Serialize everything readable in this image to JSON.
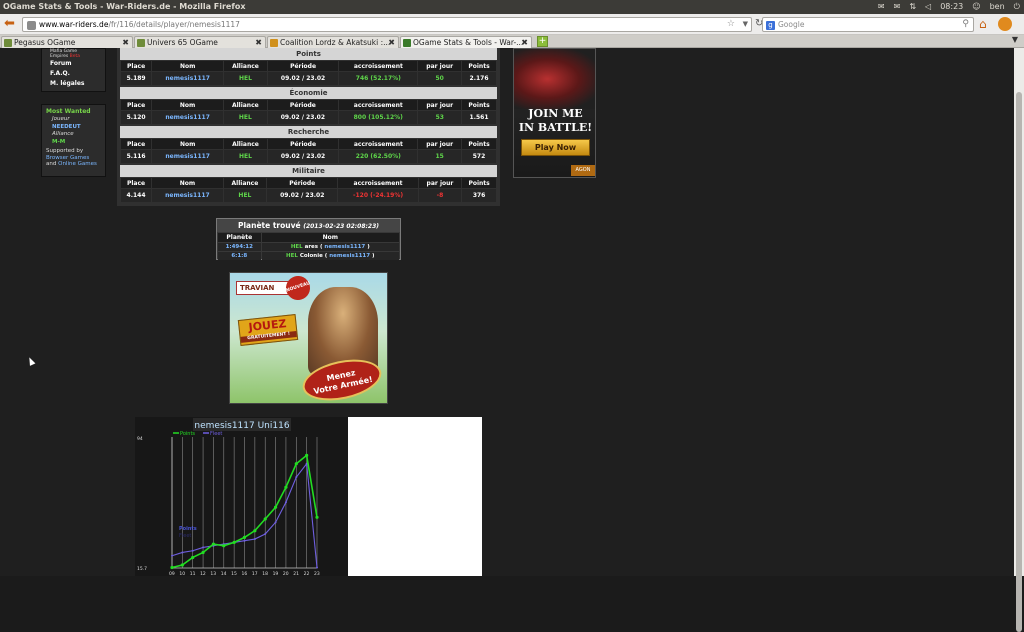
{
  "window": {
    "title": "OGame Stats & Tools - War-Riders.de - Mozilla Firefox",
    "time": "08:23",
    "user": "ben"
  },
  "navbar": {
    "url_host": "www.war-riders.de",
    "url_path": "/fr/116/details/player/nemesis1117",
    "search_placeholder": "Google"
  },
  "tabs": [
    {
      "label": "Pegasus OGame"
    },
    {
      "label": "Univers 65 OGame"
    },
    {
      "label": "Coalition Lordz & Akatsuki :..."
    },
    {
      "label": "OGame Stats & Tools - War-..."
    }
  ],
  "sidebar": {
    "mafia": "Mafia Game",
    "empires": "Empires",
    "empires_tag": "Beta",
    "forum": "Forum",
    "faq": "F.A.Q.",
    "legal": "M. légales"
  },
  "most_wanted": {
    "title": "Most Wanted",
    "joueur": "Joueur",
    "player": "NEEDEUT",
    "alliance": "Alliance",
    "alliance_name": "M-M",
    "supported": "Supported by",
    "browser_games": "Browser Games",
    "and": "and",
    "online_games": "Online Games"
  },
  "stats": {
    "headers": [
      "Place",
      "Nom",
      "Alliance",
      "Période",
      "accroissement",
      "par jour",
      "Points"
    ],
    "sections": [
      {
        "title": "Points",
        "place": "5.189",
        "nom": "nemesis1117",
        "alliance": "HEL",
        "periode": "09.02 / 23.02",
        "accroissement": "746 (52.17%)",
        "par_jour": "50",
        "points": "2.176",
        "sign": "pos"
      },
      {
        "title": "Économie",
        "place": "5.120",
        "nom": "nemesis1117",
        "alliance": "HEL",
        "periode": "09.02 / 23.02",
        "accroissement": "800 (105.12%)",
        "par_jour": "53",
        "points": "1.561",
        "sign": "pos"
      },
      {
        "title": "Recherche",
        "place": "5.116",
        "nom": "nemesis1117",
        "alliance": "HEL",
        "periode": "09.02 / 23.02",
        "accroissement": "220 (62.50%)",
        "par_jour": "15",
        "points": "572",
        "sign": "pos"
      },
      {
        "title": "Militaire",
        "place": "4.144",
        "nom": "nemesis1117",
        "alliance": "HEL",
        "periode": "09.02 / 23.02",
        "accroissement": "-120 (-24.19%)",
        "par_jour": "-8",
        "points": "376",
        "sign": "neg"
      }
    ]
  },
  "planets": {
    "title": "Planète trouvé",
    "date": "(2013-02-23 02:08:23)",
    "col_planete": "Planète",
    "col_nom": "Nom",
    "rows": [
      {
        "coord": "1:494:12",
        "ally": "HEL",
        "name": "ares",
        "open": "(",
        "owner": "nemesis1117",
        "close": ")"
      },
      {
        "coord": "6:1:8",
        "ally": "HEL",
        "name": "Colonie",
        "open": "(",
        "owner": "nemesis1117",
        "close": ")"
      }
    ]
  },
  "ads": {
    "travian_logo": "TRAVIAN",
    "travian_new": "NOUVEAU",
    "travian_play": "JOUEZ",
    "travian_play_sub": "GRATUITEMENT !",
    "travian_slogan_1": "Menez",
    "travian_slogan_2": "Votre Armée!",
    "battle_line_1": "JOIN ME",
    "battle_line_2": "IN BATTLE!",
    "battle_button": "Play Now",
    "battle_brand": "AGON"
  },
  "chart_data": {
    "type": "line",
    "title": "nemesis1117 Uni116",
    "legend": [
      "Points",
      "Fleet"
    ],
    "ylim": [
      15.7,
      94
    ],
    "ytick_labels": [
      "94",
      "15.7"
    ],
    "x": [
      "09.02",
      "10.02",
      "11.02",
      "12.02",
      "13.02",
      "14.02",
      "15.02",
      "16.02",
      "17.02",
      "18.02",
      "19.02",
      "20.02",
      "21.02",
      "22.02",
      "23.02"
    ],
    "series": [
      {
        "name": "Points",
        "color": "#22dd22",
        "values": [
          16,
          17.5,
          22,
          25,
          30,
          29,
          31,
          34,
          38,
          45,
          52,
          64,
          78,
          83,
          46
        ]
      },
      {
        "name": "Fleet",
        "color": "#6f5fe0",
        "values": [
          23,
          25,
          26,
          28,
          29,
          30,
          31,
          32,
          33,
          36,
          43,
          55,
          70,
          78,
          16
        ]
      }
    ],
    "annotations": [
      "Points",
      "Fleet"
    ],
    "colors": {
      "points": "#22dd22",
      "fleet": "#6f5fe0"
    }
  }
}
